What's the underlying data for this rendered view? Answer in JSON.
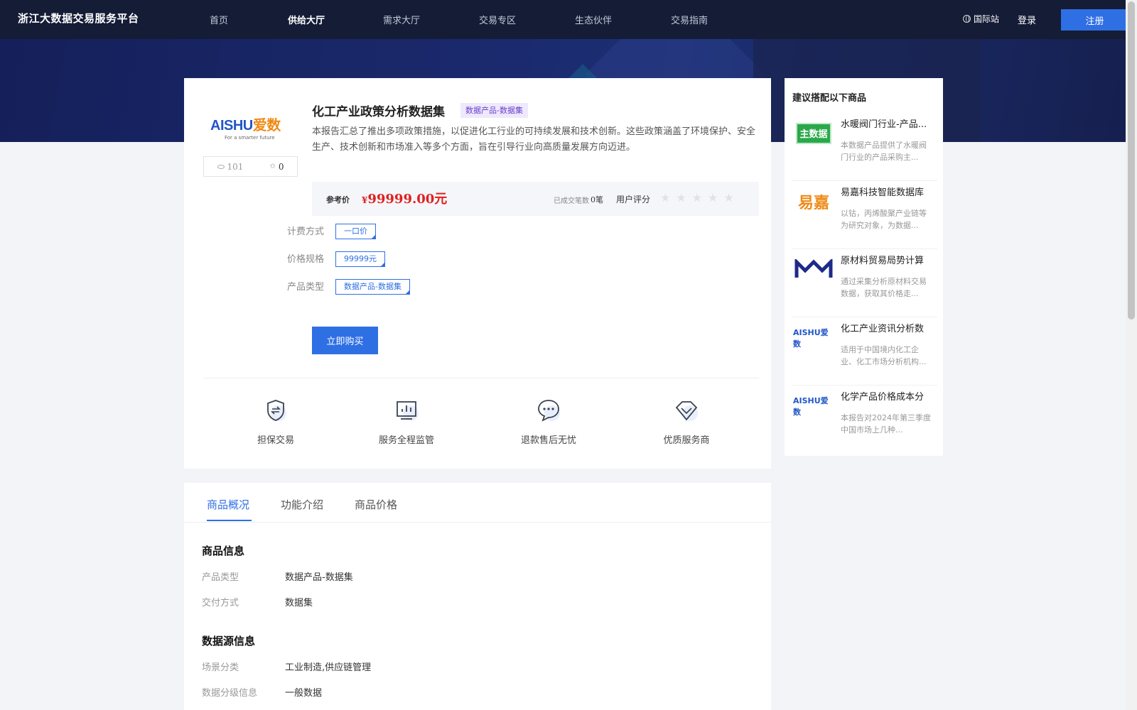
{
  "header": {
    "brand": "浙江大数据交易服务平台",
    "nav": [
      {
        "label": "首页",
        "active": false
      },
      {
        "label": "供给大厅",
        "active": true
      },
      {
        "label": "需求大厅",
        "active": false
      },
      {
        "label": "交易专区",
        "active": false
      },
      {
        "label": "生态伙伴",
        "active": false
      },
      {
        "label": "交易指南",
        "active": false
      }
    ],
    "intl_label": "国际站",
    "login_label": "登录",
    "register_label": "注册"
  },
  "product": {
    "logo_text_en": "AISHU",
    "logo_text_cn": "爱数",
    "logo_tagline": "For a smarter future",
    "views": "101",
    "favorites": "0",
    "title": "化工产业政策分析数据集",
    "category_badge": "数据产品-数据集",
    "description": "本报告汇总了推出多项政策措施，以促进化工行业的可持续发展和技术创新。这些政策涵盖了环境保护、安全生产、技术创新和市场准入等多个方面，旨在引导行业向高质量发展方向迈进。",
    "ref_price_label": "参考价",
    "price_symbol": "¥",
    "price": "99999.00元",
    "deals_label": "已成交笔数",
    "deals_value": "0笔",
    "rating_label": "用户评分",
    "rating": 0,
    "options": [
      {
        "label": "计费方式",
        "value": "一口价"
      },
      {
        "label": "价格规格",
        "value": "99999元"
      },
      {
        "label": "产品类型",
        "value": "数据产品-数据集"
      }
    ],
    "buy_label": "立即购买",
    "features": [
      {
        "icon": "shield-exchange-icon",
        "label": "担保交易"
      },
      {
        "icon": "monitor-chart-icon",
        "label": "服务全程监管"
      },
      {
        "icon": "chat-bubble-icon",
        "label": "退款售后无忧"
      },
      {
        "icon": "diamond-icon",
        "label": "优质服务商"
      }
    ]
  },
  "sidebar": {
    "title": "建议搭配以下商品",
    "items": [
      {
        "thumb": "主数据",
        "name": "水暖阀门行业-产品...",
        "desc": "本数据产品提供了水暖阀门行业的产品采购主..."
      },
      {
        "thumb": "易嘉",
        "name": "易嘉科技智能数据库",
        "desc": "以钴，丙烯酸聚产业链等为研究对象，为数据..."
      },
      {
        "thumb": "MM",
        "name": "原材料贸易局势计算",
        "desc": "通过采集分析原材料交易数据，获取其价格走..."
      },
      {
        "thumb": "AISHU爱数",
        "name": "化工产业资讯分析数",
        "desc": "适用于中国境内化工企业、化工市场分析机构..."
      },
      {
        "thumb": "AISHU爱数",
        "name": "化学产品价格成本分",
        "desc": "本报告对2024年第三季度中国市场上几种..."
      }
    ]
  },
  "tabs": {
    "items": [
      {
        "label": "商品概况",
        "active": true
      },
      {
        "label": "功能介绍",
        "active": false
      },
      {
        "label": "商品价格",
        "active": false
      }
    ],
    "sections": [
      {
        "title": "商品信息",
        "rows": [
          {
            "key": "产品类型",
            "value": "数据产品-数据集"
          },
          {
            "key": "交付方式",
            "value": "数据集"
          }
        ]
      },
      {
        "title": "数据源信息",
        "rows": [
          {
            "key": "场景分类",
            "value": "工业制造,供应链管理"
          },
          {
            "key": "数据分级信息",
            "value": "一般数据"
          }
        ]
      }
    ]
  },
  "colors": {
    "accent": "#2f6fe4",
    "price": "#e02020",
    "nav_bg": "#141c36"
  }
}
